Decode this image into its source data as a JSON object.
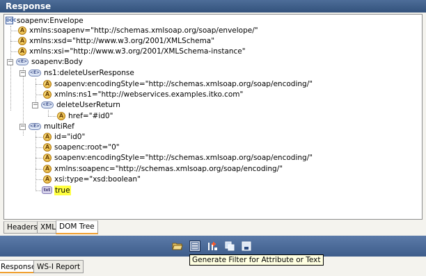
{
  "panel": {
    "title": "Response"
  },
  "tree": {
    "root": "soapenv:Envelope",
    "envelope_attrs": [
      "xmlns:soapenv=\"http://schemas.xmlsoap.org/soap/envelope/\"",
      "xmlns:xsd=\"http://www.w3.org/2001/XMLSchema\"",
      "xmlns:xsi=\"http://www.w3.org/2001/XMLSchema-instance\""
    ],
    "body": "soapenv:Body",
    "delete_response": "ns1:deleteUserResponse",
    "delete_response_attrs": [
      "soapenv:encodingStyle=\"http://schemas.xmlsoap.org/soap/encoding/\"",
      "xmlns:ns1=\"http://webservices.examples.itko.com\""
    ],
    "delete_return": "deleteUserReturn",
    "delete_return_attrs": [
      "href=\"#id0\""
    ],
    "multiref": "multiRef",
    "multiref_attrs": [
      "id=\"id0\"",
      "soapenc:root=\"0\"",
      "soapenv:encodingStyle=\"http://schemas.xmlsoap.org/soap/encoding/\"",
      "xmlns:soapenc=\"http://schemas.xmlsoap.org/soap/encoding/\"",
      "xsi:type=\"xsd:boolean\""
    ],
    "text_value": "true"
  },
  "icons": {
    "attribute": "A",
    "element": "<E>",
    "document": "DOC",
    "text": "txt",
    "expanded": "−"
  },
  "inner_tabs": [
    "Headers",
    "XML",
    "DOM Tree"
  ],
  "inner_active": "DOM Tree",
  "toolbar": {
    "buttons": [
      "open-folder-icon",
      "filter-icon",
      "add-node-icon",
      "copy-icon",
      "save-icon"
    ]
  },
  "tooltip": "Generate Filter for Attribute or Text",
  "outer_tabs": [
    "Response",
    "WS-I Report"
  ],
  "outer_active": "Response"
}
